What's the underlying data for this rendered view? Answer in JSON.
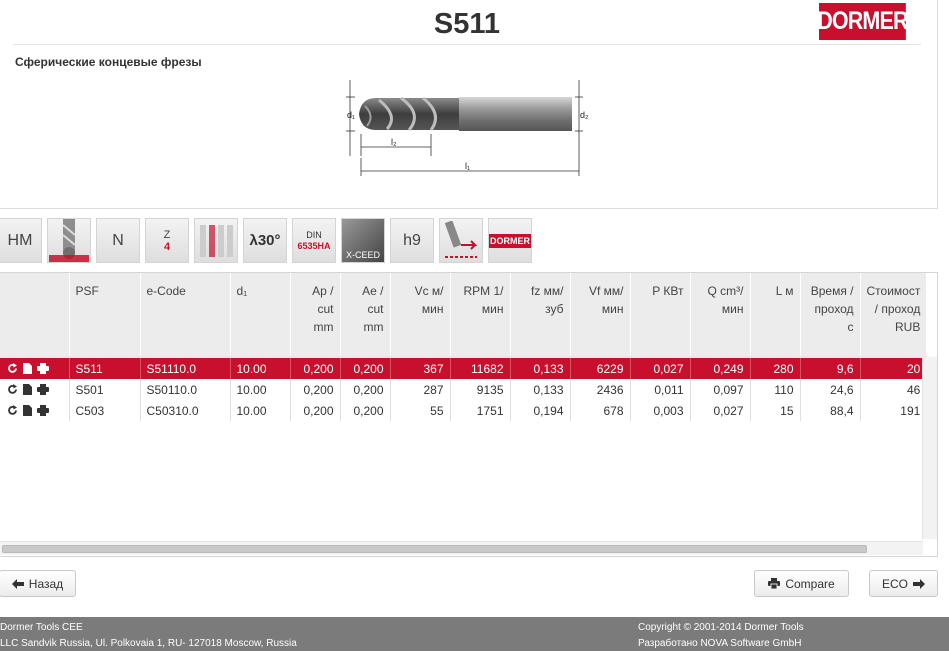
{
  "header": {
    "title": "S511",
    "brand": "DORMER",
    "subtitle": "Сферические концевые фрезы"
  },
  "drawing": {
    "labels": {
      "d1": "d₁",
      "d2": "d₂",
      "l2": "l₂",
      "l1": "l₁"
    }
  },
  "icons": [
    {
      "name": "hm-material-icon",
      "text": "HM"
    },
    {
      "name": "ball-nose-tool-icon",
      "text": ""
    },
    {
      "name": "n-type-icon",
      "text": "N"
    },
    {
      "name": "z-flutes-icon",
      "text": "Z",
      "sub": "4"
    },
    {
      "name": "coolant-icon",
      "text": ""
    },
    {
      "name": "helix-30-icon",
      "text": "λ30°"
    },
    {
      "name": "din-6535ha-icon",
      "text": "DIN",
      "sub": "6535HA"
    },
    {
      "name": "x-ceed-coating-icon",
      "text": "X-CEED"
    },
    {
      "name": "h9-tolerance-icon",
      "text": "h9"
    },
    {
      "name": "ramping-icon",
      "text": ""
    },
    {
      "name": "dormer-brand-icon",
      "text": "DORMER"
    }
  ],
  "table": {
    "columns": [
      {
        "key": "actions",
        "label": ""
      },
      {
        "key": "psf",
        "label": "PSF"
      },
      {
        "key": "ecode",
        "label": "e-Code"
      },
      {
        "key": "d1",
        "label": "d₁"
      },
      {
        "key": "ap",
        "label": "Ap / cut mm"
      },
      {
        "key": "ae",
        "label": "Ae / cut mm"
      },
      {
        "key": "vc",
        "label": "Vc м/мин"
      },
      {
        "key": "rpm",
        "label": "RPM 1/мин"
      },
      {
        "key": "fz",
        "label": "fz мм/зуб"
      },
      {
        "key": "vf",
        "label": "Vf мм/мин"
      },
      {
        "key": "p",
        "label": "P КВт"
      },
      {
        "key": "q",
        "label": "Q cm³/ мин"
      },
      {
        "key": "l",
        "label": "L м"
      },
      {
        "key": "time",
        "label": "Время / проход с"
      },
      {
        "key": "cost",
        "label": "Стоимост / проход RUB"
      }
    ],
    "rows": [
      {
        "selected": true,
        "psf": "S511",
        "ecode": "S51110.0",
        "d1": "10.00",
        "ap": "0,200",
        "ae": "0,200",
        "vc": "367",
        "rpm": "11682",
        "fz": "0,133",
        "vf": "6229",
        "p": "0,027",
        "q": "0,249",
        "l": "280",
        "time": "9,6",
        "cost": "20"
      },
      {
        "selected": false,
        "psf": "S501",
        "ecode": "S50110.0",
        "d1": "10.00",
        "ap": "0,200",
        "ae": "0,200",
        "vc": "287",
        "rpm": "9135",
        "fz": "0,133",
        "vf": "2436",
        "p": "0,011",
        "q": "0,097",
        "l": "110",
        "time": "24,6",
        "cost": "46"
      },
      {
        "selected": false,
        "psf": "C503",
        "ecode": "C50310.0",
        "d1": "10.00",
        "ap": "0,200",
        "ae": "0,200",
        "vc": "55",
        "rpm": "1751",
        "fz": "0,194",
        "vf": "678",
        "p": "0,003",
        "q": "0,027",
        "l": "15",
        "time": "88,4",
        "cost": "191"
      }
    ]
  },
  "buttons": {
    "back": "Назад",
    "compare": "Compare",
    "eco": "ECO"
  },
  "footer": {
    "company": "Dormer Tools CEE",
    "address": "LLC Sandvik Russia, Ul. Polkovaia 1, RU- 127018 Moscow, Russia",
    "copyright": "Copyright © 2001-2014 Dormer Tools",
    "developer": "Разработано NOVA Software GmbH"
  },
  "colors": {
    "brand_red": "#c8102e",
    "footer_gray": "#7b7b7b"
  }
}
